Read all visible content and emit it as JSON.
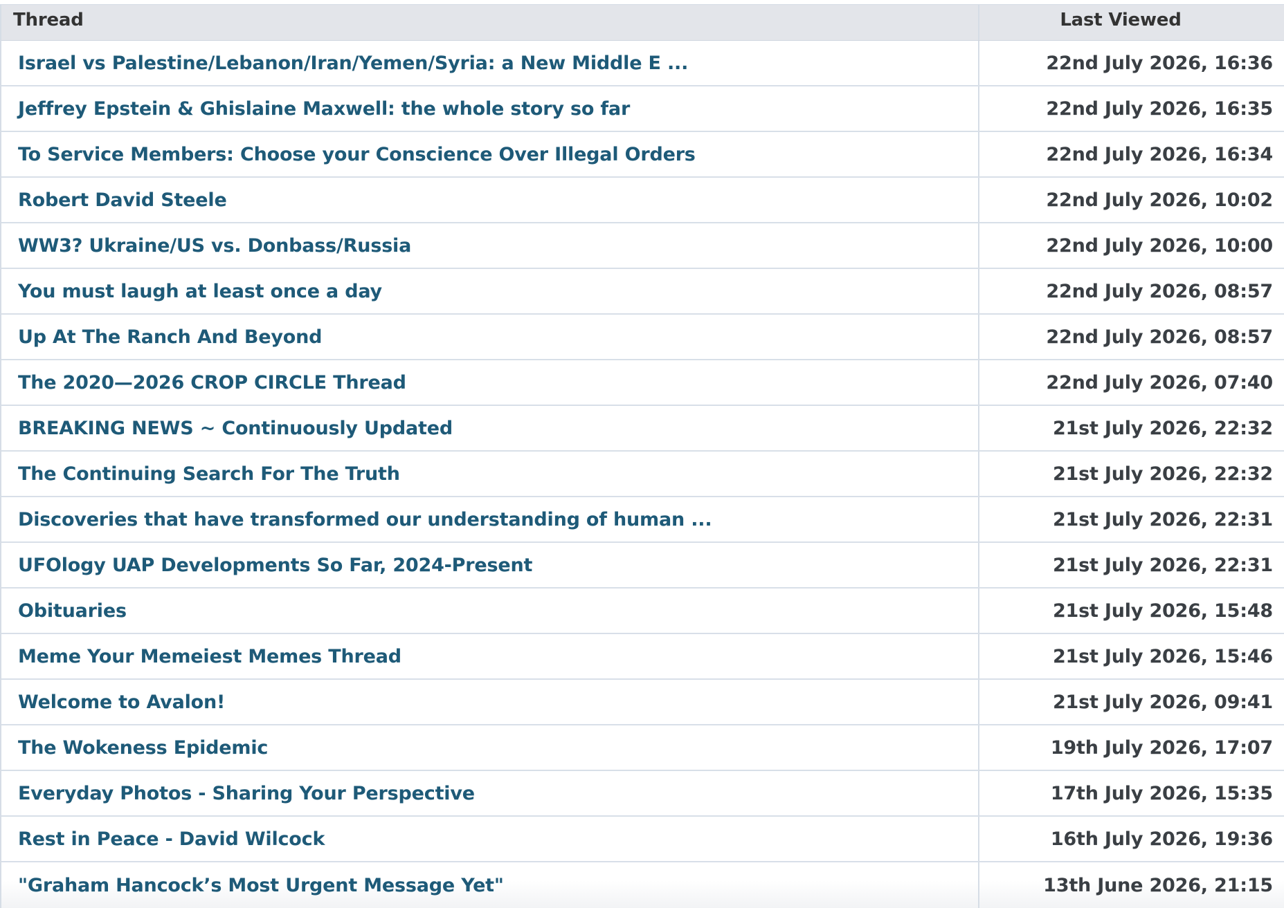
{
  "header": {
    "thread_label": "Thread",
    "last_viewed_label": "Last Viewed"
  },
  "rows": [
    {
      "title": "Israel vs Palestine/Lebanon/Iran/Yemen/Syria: a New Middle E ...",
      "last_viewed": "22nd July 2026, 16:36"
    },
    {
      "title": "Jeffrey Epstein & Ghislaine Maxwell: the whole story so far",
      "last_viewed": "22nd July 2026, 16:35"
    },
    {
      "title": "To Service Members: Choose your Conscience Over Illegal Orders",
      "last_viewed": "22nd July 2026, 16:34"
    },
    {
      "title": "Robert David Steele",
      "last_viewed": "22nd July 2026, 10:02"
    },
    {
      "title": "WW3? Ukraine/US vs. Donbass/Russia",
      "last_viewed": "22nd July 2026, 10:00"
    },
    {
      "title": "You must laugh at least once a day",
      "last_viewed": "22nd July 2026, 08:57"
    },
    {
      "title": "Up At The Ranch And Beyond",
      "last_viewed": "22nd July 2026, 08:57"
    },
    {
      "title": "The 2020—2026 CROP CIRCLE Thread",
      "last_viewed": "22nd July 2026, 07:40"
    },
    {
      "title": "BREAKING NEWS ~ Continuously Updated",
      "last_viewed": "21st July 2026, 22:32"
    },
    {
      "title": "The Continuing Search For The Truth",
      "last_viewed": "21st July 2026, 22:32"
    },
    {
      "title": "Discoveries that have transformed our understanding of human ...",
      "last_viewed": "21st July 2026, 22:31"
    },
    {
      "title": "UFOlogy UAP Developments So Far, 2024-Present",
      "last_viewed": "21st July 2026, 22:31"
    },
    {
      "title": "Obituaries",
      "last_viewed": "21st July 2026, 15:48"
    },
    {
      "title": "Meme Your Memeiest Memes Thread",
      "last_viewed": "21st July 2026, 15:46"
    },
    {
      "title": "Welcome to Avalon!",
      "last_viewed": "21st July 2026, 09:41"
    },
    {
      "title": "The Wokeness Epidemic",
      "last_viewed": "19th July 2026, 17:07"
    },
    {
      "title": "Everyday Photos - Sharing Your Perspective",
      "last_viewed": "17th July 2026, 15:35"
    },
    {
      "title": "Rest in Peace - David Wilcock",
      "last_viewed": "16th July 2026, 19:36"
    },
    {
      "title": "\"Graham Hancock’s Most Urgent Message Yet\"",
      "last_viewed": "13th June 2026, 21:15"
    }
  ],
  "colors": {
    "link": "#1e5a78",
    "date_text": "#3a3f44",
    "header_bg": "#e3e5ea",
    "border": "#d8dfe8"
  }
}
